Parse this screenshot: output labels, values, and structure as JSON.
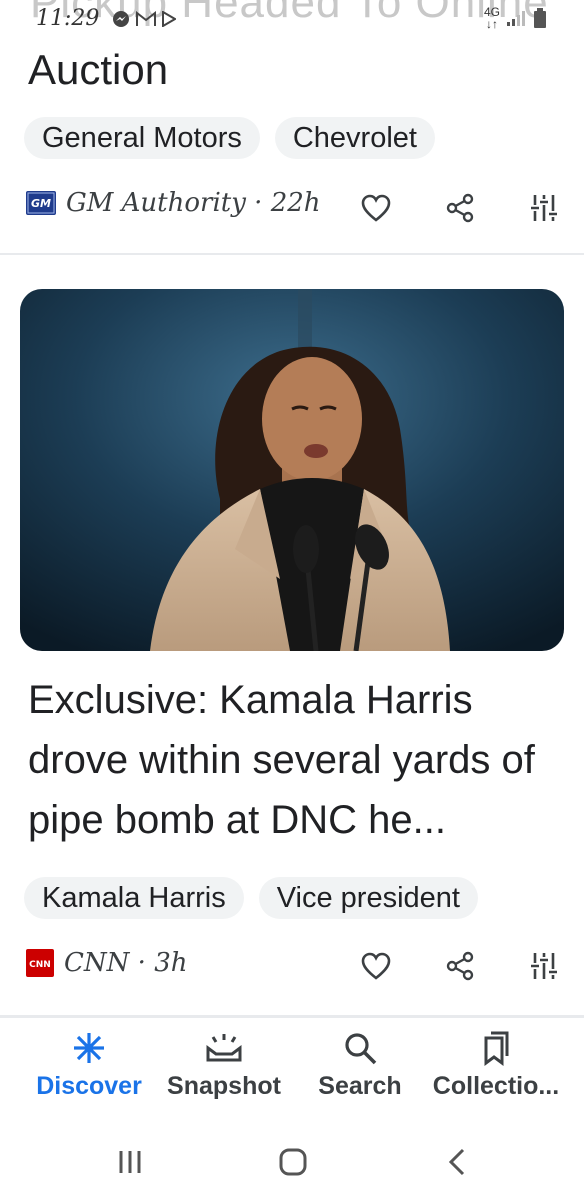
{
  "status_bar": {
    "time": "11:29",
    "network": "4G",
    "ghost_title": "Pickup Headed To Online"
  },
  "card1": {
    "headline": "Auction",
    "chips": [
      "General Motors",
      "Chevrolet"
    ],
    "source": "GM Authority · 22h",
    "logo_text": "GM",
    "icons": [
      "heart-icon",
      "share-icon",
      "tune-icon"
    ]
  },
  "card2": {
    "headline": "Exclusive: Kamala Harris drove within several yards of pipe bomb at DNC he...",
    "chips": [
      "Kamala Harris",
      "Vice president"
    ],
    "source": "CNN · 3h",
    "logo_text": "CNN",
    "icons": [
      "heart-icon",
      "share-icon",
      "tune-icon"
    ]
  },
  "bottom_nav": {
    "items": [
      {
        "label": "Discover",
        "icon": "discover-icon",
        "active": true
      },
      {
        "label": "Snapshot",
        "icon": "snapshot-icon",
        "active": false
      },
      {
        "label": "Search",
        "icon": "search-icon",
        "active": false
      },
      {
        "label": "Collectio...",
        "icon": "collections-icon",
        "active": false
      }
    ]
  },
  "colors": {
    "accent": "#1a73e8",
    "chip_bg": "#f1f3f4",
    "cnn_red": "#cc0000"
  }
}
